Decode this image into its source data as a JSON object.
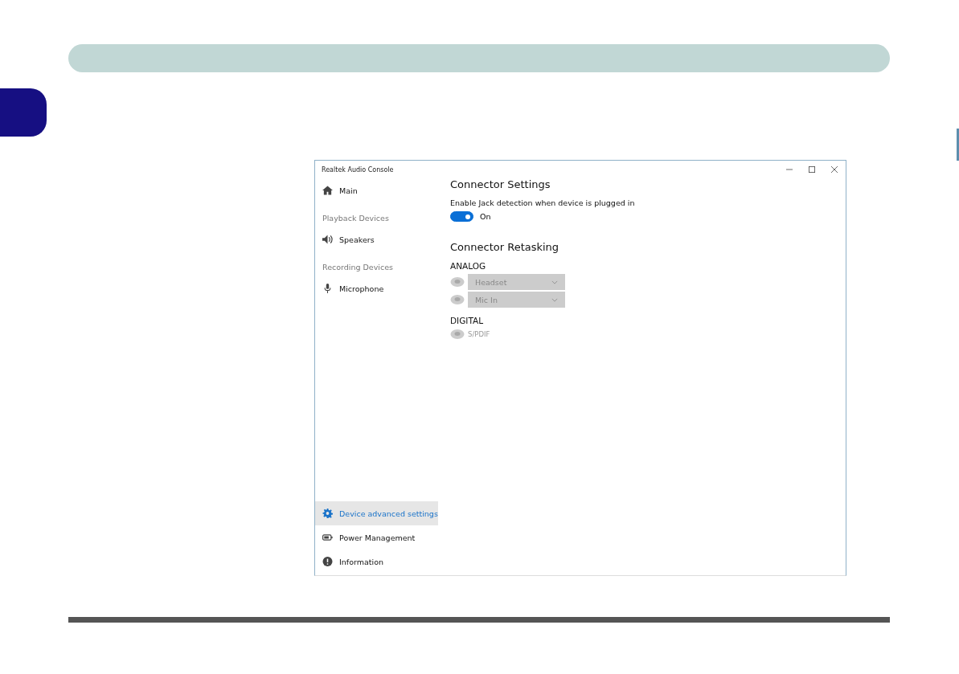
{
  "window": {
    "title": "Realtek Audio Console"
  },
  "sidebar": {
    "items": [
      {
        "kind": "nav",
        "label": "Main",
        "selected": false
      },
      {
        "kind": "header",
        "label": "Playback Devices"
      },
      {
        "kind": "nav",
        "label": "Speakers",
        "selected": false
      },
      {
        "kind": "header",
        "label": "Recording Devices"
      },
      {
        "kind": "nav",
        "label": "Microphone",
        "selected": false
      }
    ],
    "bottom_items": [
      {
        "kind": "nav",
        "label": "Device advanced settings",
        "selected": true
      },
      {
        "kind": "nav",
        "label": "Power Management",
        "selected": false
      },
      {
        "kind": "nav",
        "label": "Information",
        "selected": false
      }
    ]
  },
  "connector_settings": {
    "title": "Connector Settings",
    "description": "Enable Jack detection when device is plugged in",
    "toggle": {
      "on": true,
      "label": "On"
    }
  },
  "connector_retasking": {
    "title": "Connector Retasking",
    "groups": [
      {
        "title": "ANALOG",
        "connectors": [
          {
            "kind": "dropdown",
            "value": "Headset",
            "disabled": true
          },
          {
            "kind": "dropdown",
            "value": "Mic In",
            "disabled": true
          }
        ]
      },
      {
        "title": "DIGITAL",
        "connectors": [
          {
            "kind": "label",
            "value": "S/PDIF",
            "disabled": true
          }
        ]
      }
    ]
  }
}
